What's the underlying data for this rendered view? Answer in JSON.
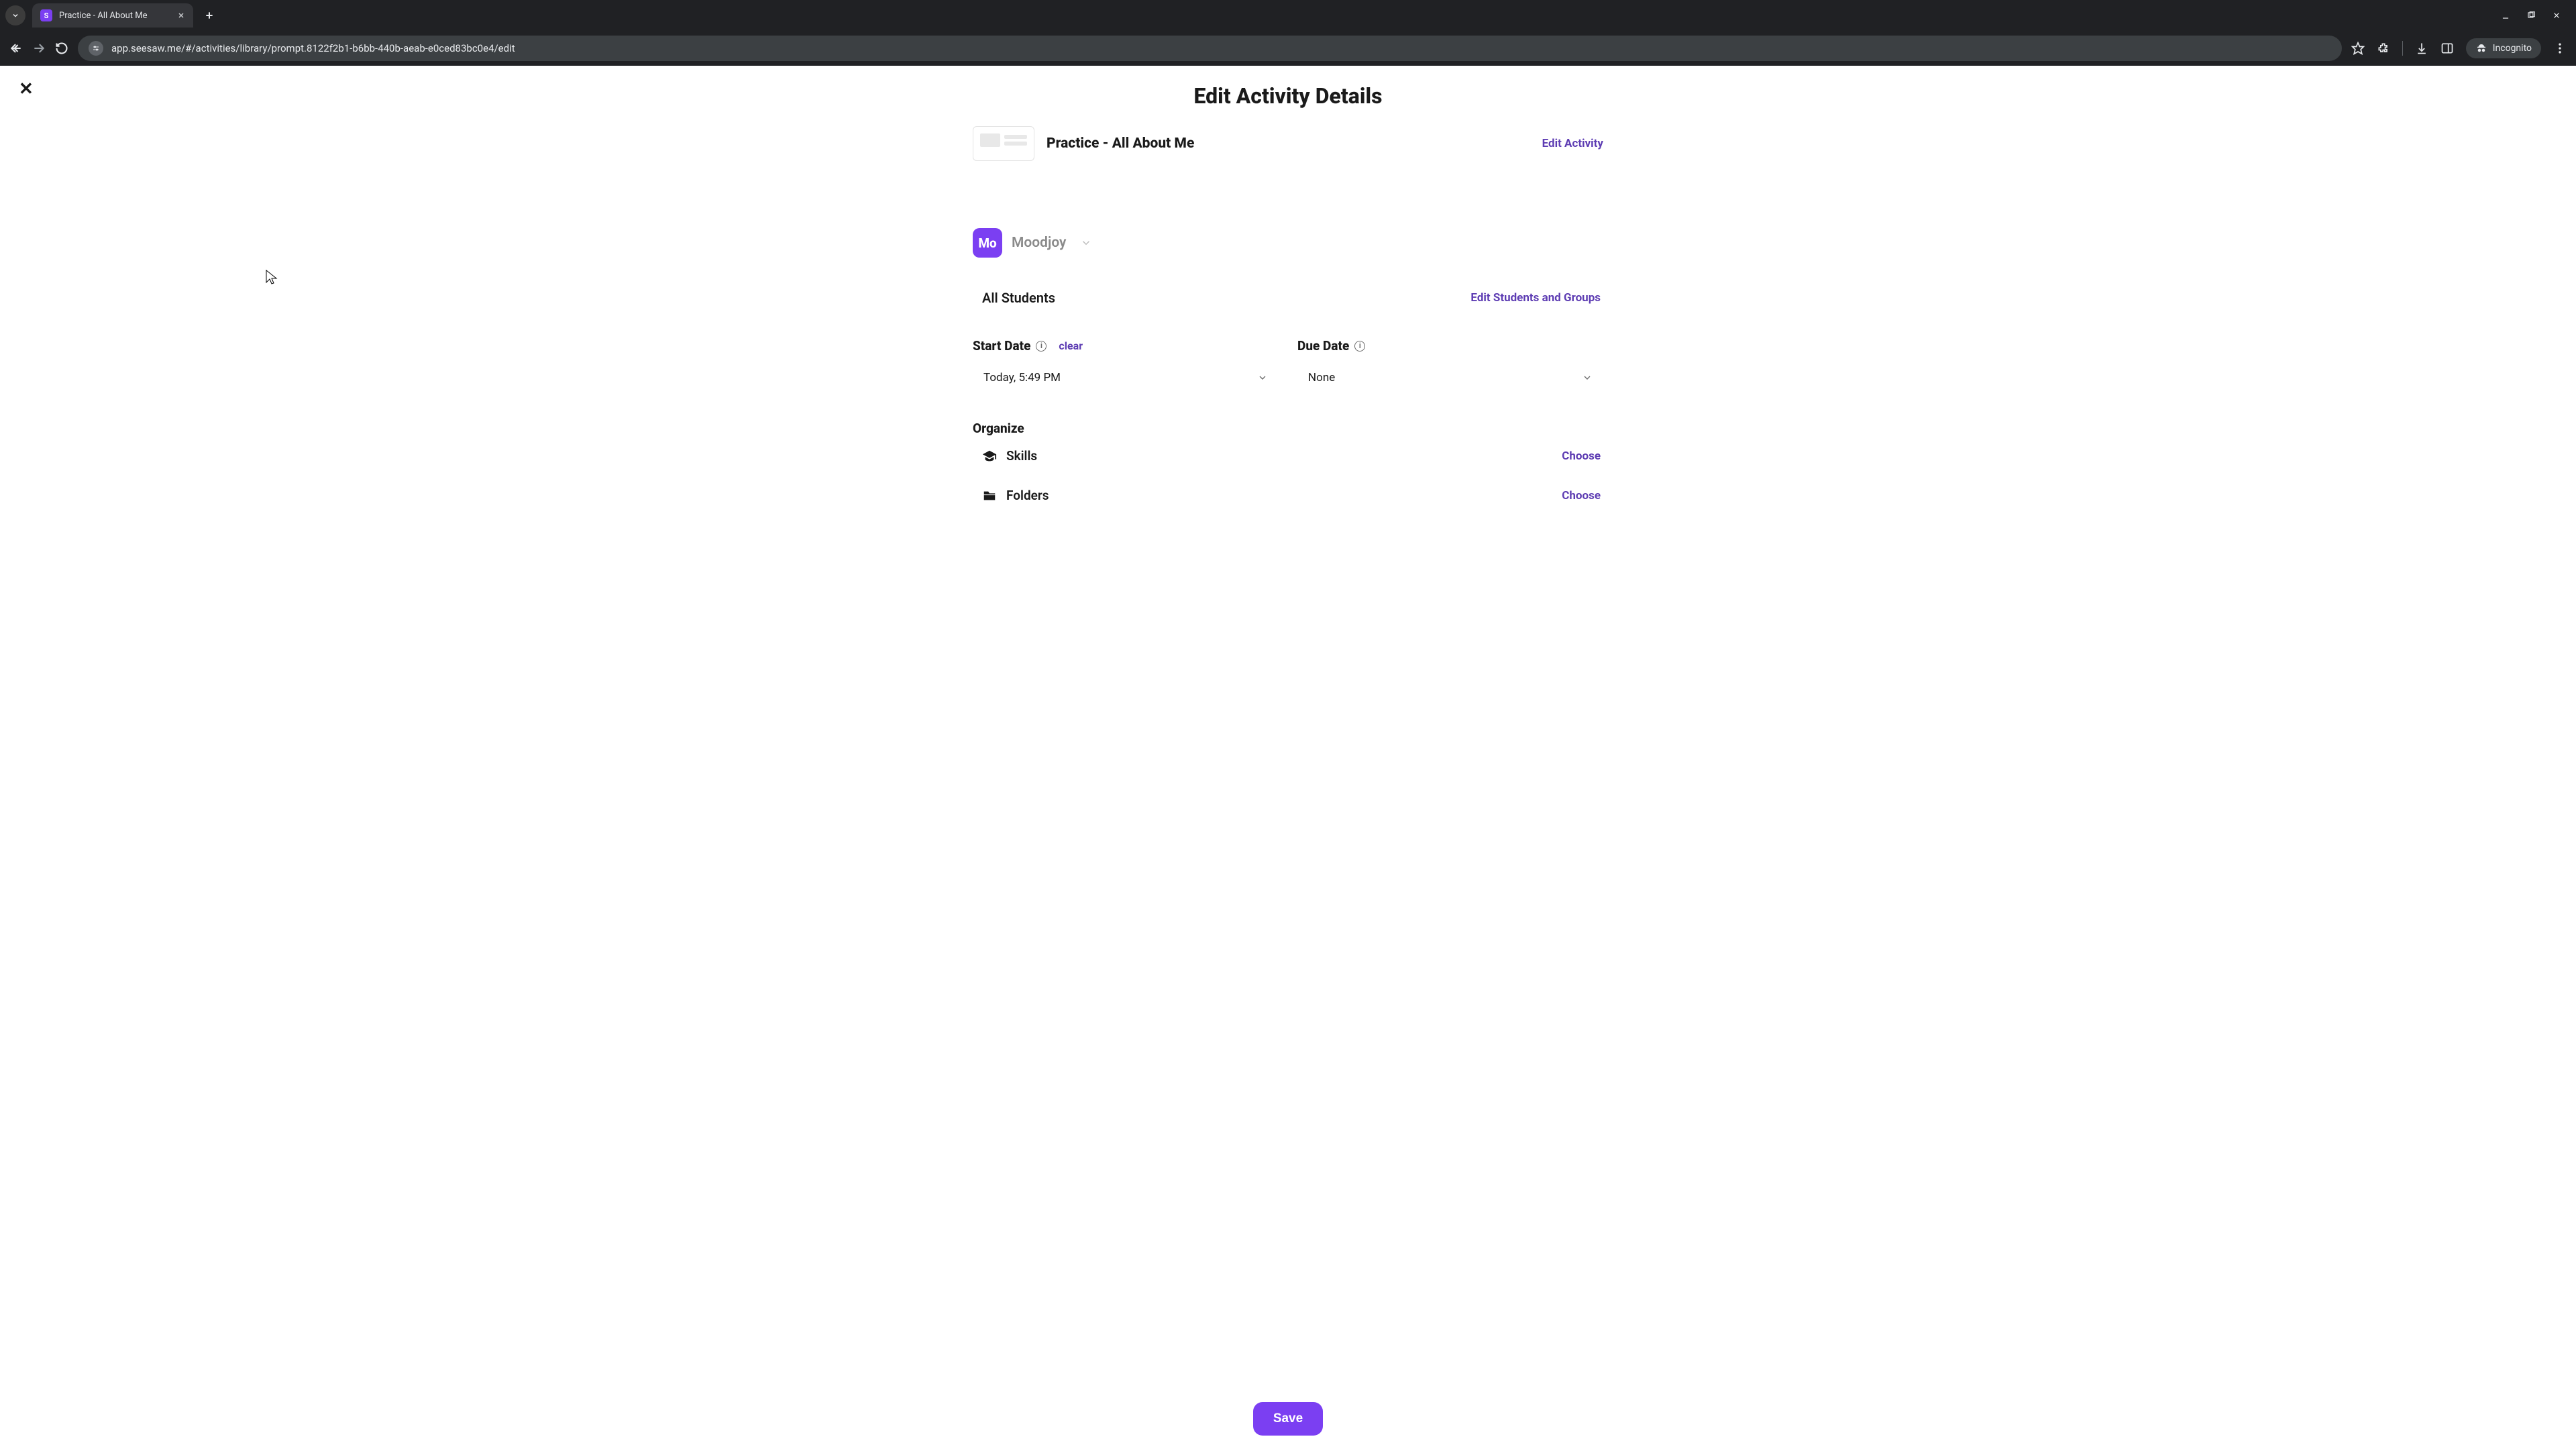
{
  "browser": {
    "tab_title": "Practice - All About Me",
    "favicon_letter": "S",
    "url": "app.seesaw.me/#/activities/library/prompt.8122f2b1-b6bb-440b-aeab-e0ced83bc0e4/edit",
    "incognito_label": "Incognito"
  },
  "page": {
    "title": "Edit Activity Details",
    "activity_name": "Practice - All About Me",
    "edit_activity_label": "Edit Activity",
    "class": {
      "avatar_text": "Mo",
      "name": "Moodjoy"
    },
    "students": {
      "label": "All Students",
      "edit_label": "Edit Students and Groups"
    },
    "dates": {
      "start_label": "Start Date",
      "clear_label": "clear",
      "start_value": "Today, 5:49 PM",
      "due_label": "Due Date",
      "due_value": "None"
    },
    "organize": {
      "title": "Organize",
      "skills_label": "Skills",
      "folders_label": "Folders",
      "choose_label": "Choose"
    },
    "save_label": "Save"
  }
}
